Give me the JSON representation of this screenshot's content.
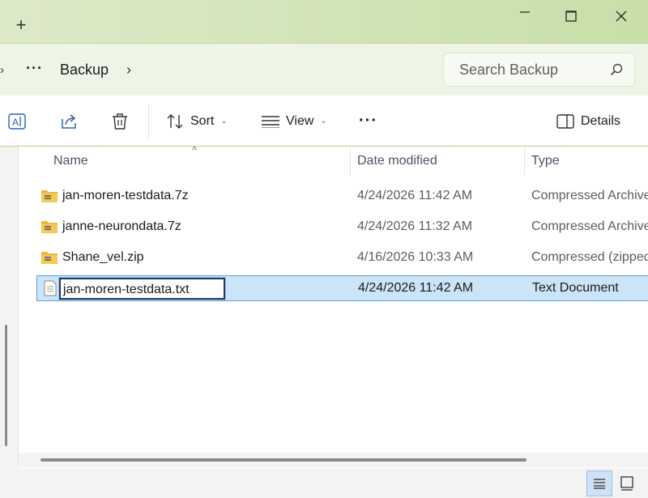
{
  "window": {
    "new_tab_symbol": "+",
    "controls": [
      "minimize",
      "maximize",
      "close"
    ]
  },
  "address_bar": {
    "more_symbol": "···",
    "crumb": "Backup",
    "search_placeholder": "Search Backup"
  },
  "toolbar": {
    "sort_label": "Sort",
    "view_label": "View",
    "more_symbol": "···",
    "details_label": "Details"
  },
  "columns": {
    "name": "Name",
    "date_modified": "Date modified",
    "type": "Type"
  },
  "files": [
    {
      "name": "jan-moren-testdata.7z",
      "date": "4/24/2026 11:42 AM",
      "type": "Compressed Archive",
      "icon": "zip-folder-icon"
    },
    {
      "name": "janne-neurondata.7z",
      "date": "4/24/2026 11:32 AM",
      "type": "Compressed Archive",
      "icon": "zip-folder-icon"
    },
    {
      "name": "Shane_vel.zip",
      "date": "4/16/2026 10:33 AM",
      "type": "Compressed (zipped",
      "icon": "zip-folder-icon"
    },
    {
      "name": "jan-moren-testdata.txt",
      "date": "4/24/2026 11:42 AM",
      "type": "Text Document",
      "icon": "text-file-icon",
      "selected": true,
      "renaming": true
    }
  ],
  "colors": {
    "accent": "#5fa0dc",
    "selection": "#cce4f7",
    "folder": "#f0b93a"
  }
}
